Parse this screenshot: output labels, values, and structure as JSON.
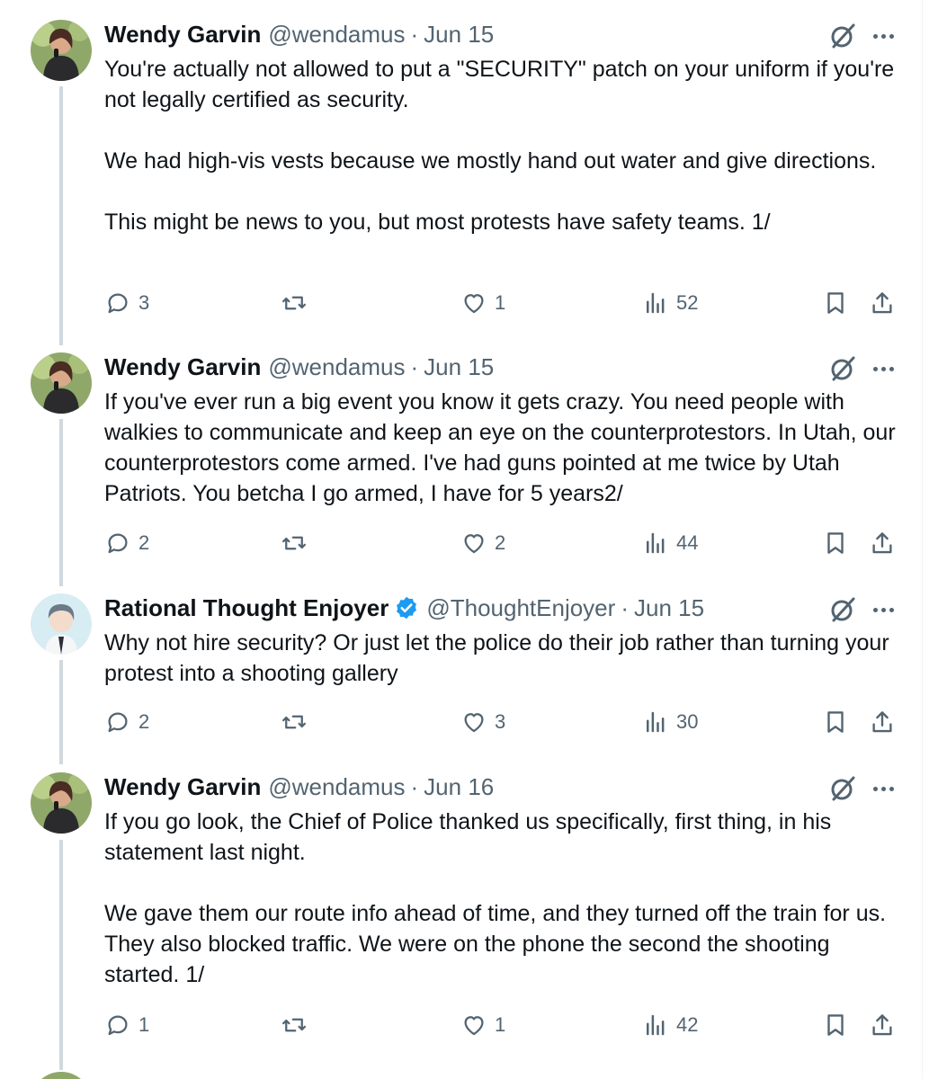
{
  "tweets": [
    {
      "name": "Wendy Garvin",
      "handle": "@wendamus",
      "separator": "·",
      "date": "Jun 15",
      "verified": false,
      "text": "You're actually not allowed to put a \"SECURITY\" patch on your uniform if you're not legally certified as security.\n\nWe had high-vis vests because we mostly hand out water and give directions.\n\nThis might be news to you, but most protests have safety teams. 1/",
      "replies": "3",
      "retweets": "",
      "likes": "1",
      "views": "52"
    },
    {
      "name": "Wendy Garvin",
      "handle": "@wendamus",
      "separator": "·",
      "date": "Jun 15",
      "verified": false,
      "text": "If you've ever run a big event you know it gets crazy. You need people with walkies to communicate and keep an eye on the counterprotestors. In Utah, our counterprotestors come armed. I've had guns pointed at me twice by Utah Patriots. You betcha I go armed, I have for 5 years2/",
      "replies": "2",
      "retweets": "",
      "likes": "2",
      "views": "44"
    },
    {
      "name": "Rational Thought Enjoyer",
      "handle": "@ThoughtEnjoyer",
      "separator": "·",
      "date": "Jun 15",
      "verified": true,
      "text": "Why not hire security? Or just let the police do their job rather than turning your protest into a shooting gallery",
      "replies": "2",
      "retweets": "",
      "likes": "3",
      "views": "30"
    },
    {
      "name": "Wendy Garvin",
      "handle": "@wendamus",
      "separator": "·",
      "date": "Jun 16",
      "verified": false,
      "text": "If you go look, the Chief of Police thanked us specifically, first thing, in his statement last night.\n\nWe gave them our route info ahead of time, and they turned off the train for us. They also blocked traffic. We were on the phone the second the shooting started. 1/",
      "replies": "1",
      "retweets": "",
      "likes": "1",
      "views": "42"
    }
  ],
  "colors": {
    "text": "#0f1419",
    "secondary": "#536471",
    "verified": "#1d9bf0",
    "thread_line": "#cfd9de"
  },
  "icons": [
    "reply-icon",
    "retweet-icon",
    "like-icon",
    "views-icon",
    "bookmark-icon",
    "share-icon",
    "grok-icon",
    "more-icon",
    "verified-badge-icon"
  ]
}
